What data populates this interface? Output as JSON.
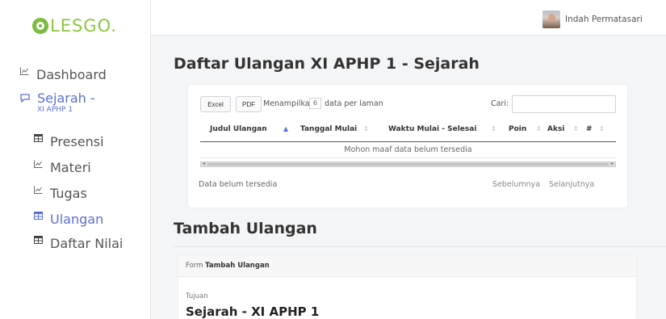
{
  "app": {
    "logo": "LESGO."
  },
  "user": {
    "name": "Indah Permatasari"
  },
  "sidebar": {
    "dashboard": "Dashboard",
    "course_line1": "Sejarah -",
    "course_line2": "XI APHP 1",
    "items": [
      "Presensi",
      "Materi",
      "Tugas",
      "Ulangan",
      "Daftar Nilai"
    ],
    "active_item": "Ulangan"
  },
  "main": {
    "title": "Daftar Ulangan XI APHP 1 - Sejarah",
    "table": {
      "btn_excel": "Excel",
      "btn_pdf": "PDF",
      "show_prefix": "Menampilkan",
      "show_value": "6",
      "show_suffix": "data per laman",
      "search_label": "Cari:",
      "search_value": "",
      "columns": [
        "Judul Ulangan",
        "Tanggal Mulai",
        "Waktu Mulai - Selesai",
        "Poin",
        "Aksi",
        "#"
      ],
      "empty_message": "Mohon maaf data belum tersedia",
      "info": "Data belum tersedia",
      "prev": "Sebelumnya",
      "next": "Selanjutnya"
    },
    "section_title": "Tambah Ulangan",
    "form": {
      "head_prefix": "Form",
      "head_bold": "Tambah Ulangan",
      "label_tujuan": "Tujuan",
      "value_tujuan": "Sejarah - XI APHP 1"
    }
  },
  "colors": {
    "accent": "#5b6fd6",
    "brand": "#8ec63f"
  },
  "icons": {
    "dashboard": "chart-icon",
    "course": "chat-icon",
    "table": "table-icon",
    "chart": "chart-icon"
  }
}
